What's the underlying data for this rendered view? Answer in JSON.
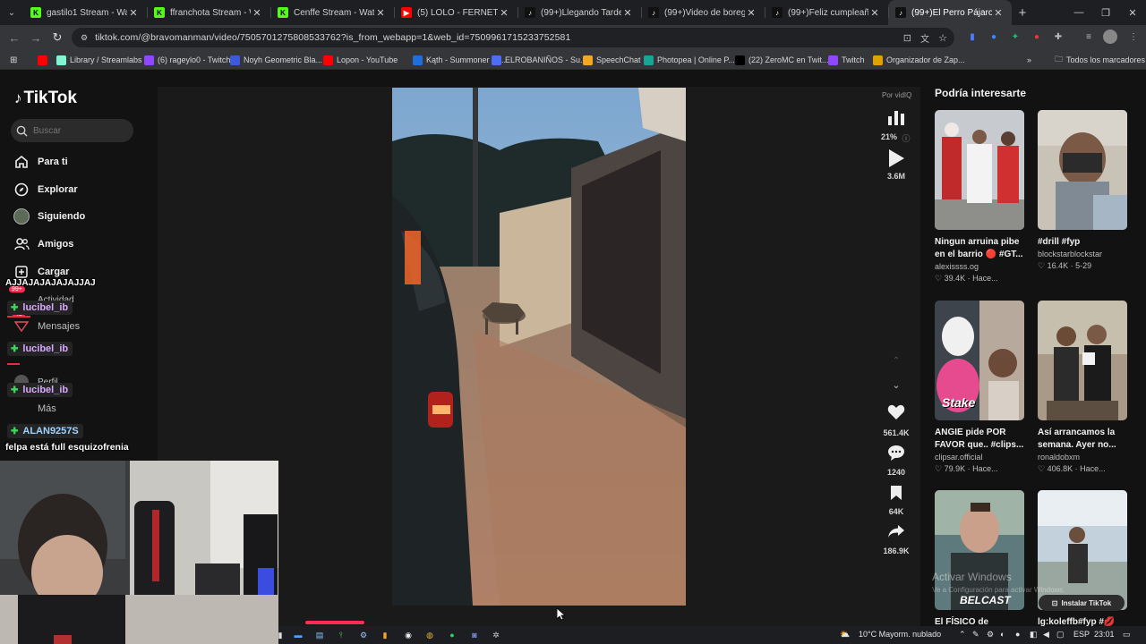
{
  "browser": {
    "tabs": [
      {
        "title": "gastilo1 Stream - Watch Li",
        "fav": "K",
        "fav_color": "#53fc18",
        "fav_text": "#000"
      },
      {
        "title": "ffranchota Stream - Watch",
        "fav": "K",
        "fav_color": "#53fc18",
        "fav_text": "#000"
      },
      {
        "title": "Cenffe Stream - Watch Live",
        "fav": "K",
        "fav_color": "#53fc18",
        "fav_text": "#000"
      },
      {
        "title": "(5) LOLO - FERNET HIELO",
        "fav": "▶",
        "fav_color": "#ff0000",
        "fav_text": "#fff"
      },
      {
        "title": "(99+)Llegando Tarde a la",
        "fav": "♪",
        "fav_color": "#111",
        "fav_text": "#fff"
      },
      {
        "title": "(99+)Video de boregu",
        "fav": "♪",
        "fav_color": "#111",
        "fav_text": "#fff"
      },
      {
        "title": "(99+)Feliz cumpleaños S",
        "fav": "♪",
        "fav_color": "#111",
        "fav_text": "#fff"
      },
      {
        "title": "(99+)El Perro Pájaros",
        "fav": "♪",
        "fav_color": "#111",
        "fav_text": "#fff"
      }
    ],
    "url": "tiktok.com/@bravomanman/video/7505701275808533762?is_from_webapp=1&web_id=7509961715233752581",
    "bookmarks": [
      {
        "label": "",
        "color": "#ff0000"
      },
      {
        "label": "Library / Streamlabs",
        "color": "#80f5d2"
      },
      {
        "label": "(6) rageylo0 - Twitch",
        "color": "#9146ff"
      },
      {
        "label": "Noyh Geometric Bla...",
        "color": "#3b5bdb"
      },
      {
        "label": "Lopon - YouTube",
        "color": "#ff0000"
      },
      {
        "label": "Kąth - Summoner St...",
        "color": "#1e6fd9"
      },
      {
        "label": "ELROBANIÑOS - Su...",
        "color": "#4c6ef5"
      },
      {
        "label": "SpeechChat",
        "color": "#f5a623"
      },
      {
        "label": "Photopea | Online P...",
        "color": "#18a497"
      },
      {
        "label": "(22) ZeroMC en Twit...",
        "color": "#000000"
      },
      {
        "label": "Twitch",
        "color": "#9146ff"
      },
      {
        "label": "Organizador de Zap...",
        "color": "#e0a000"
      }
    ],
    "all_bookmarks": "Todos los marcadores"
  },
  "sidebar": {
    "logo": "TikTok",
    "search_placeholder": "Buscar",
    "nav": [
      {
        "label": "Para ti",
        "icon": "home-icon"
      },
      {
        "label": "Explorar",
        "icon": "compass-icon"
      },
      {
        "label": "Siguiendo",
        "icon": "following-avatar-icon"
      },
      {
        "label": "Amigos",
        "icon": "friends-icon"
      },
      {
        "label": "Cargar",
        "icon": "upload-icon"
      },
      {
        "label": "Actividad",
        "icon": "activity-icon"
      },
      {
        "label": "Mensajes",
        "icon": "messages-icon"
      },
      {
        "label": "Perfil",
        "icon": "profile-icon"
      },
      {
        "label": "Más",
        "icon": "more-icon"
      }
    ]
  },
  "chat": {
    "msg1": "AJJAJAJAJAJAJJAJ",
    "users": [
      "lucibel_ib",
      "lucibel_ib",
      "lucibel_ib",
      "ALAN9257S"
    ],
    "msg2": "felpa está full esquizofrenia",
    "badge_99": "99+",
    "badge_43": "43"
  },
  "video": {
    "vidiq_label": "Por vidIQ",
    "engagement": "21%",
    "views": "3.6M",
    "likes": "561.4K",
    "comments": "1240",
    "saves": "64K",
    "shares": "186.9K",
    "progress": 0.11
  },
  "recommended": {
    "title": "Podría interesarte",
    "items": [
      {
        "title": "Ningun arruina pibe en el barrio 🔴 #GT...",
        "author": "alexissss.og",
        "likes": "39.4K",
        "date": "Hace..."
      },
      {
        "title": "#drill #fyp",
        "author": "blockstarblockstar",
        "likes": "16.4K",
        "date": "5-29"
      },
      {
        "title": "ANGIE pide POR FAVOR que.. #clips...",
        "author": "clipsar.official",
        "likes": "79.9K",
        "date": "Hace..."
      },
      {
        "title": "Así arrancamos la semana. Ayer no...",
        "author": "ronaldobxm",
        "likes": "406.8K",
        "date": "Hace..."
      },
      {
        "title": "El FÍSICO de",
        "author": "",
        "likes": "",
        "date": ""
      },
      {
        "title": "lg:koleffb#fyp #💋",
        "author": "",
        "likes": "",
        "date": ""
      }
    ],
    "stake_label": "Stake",
    "belcast_label": "BELCAST"
  },
  "windows": {
    "activate_title": "Activar Windows",
    "activate_sub": "Ve a Configuración para activar Windows.",
    "install_label": "Instalar TikTok",
    "weather": "10°C  Mayorm. nublado",
    "lang": "ESP",
    "time": "23:01"
  }
}
